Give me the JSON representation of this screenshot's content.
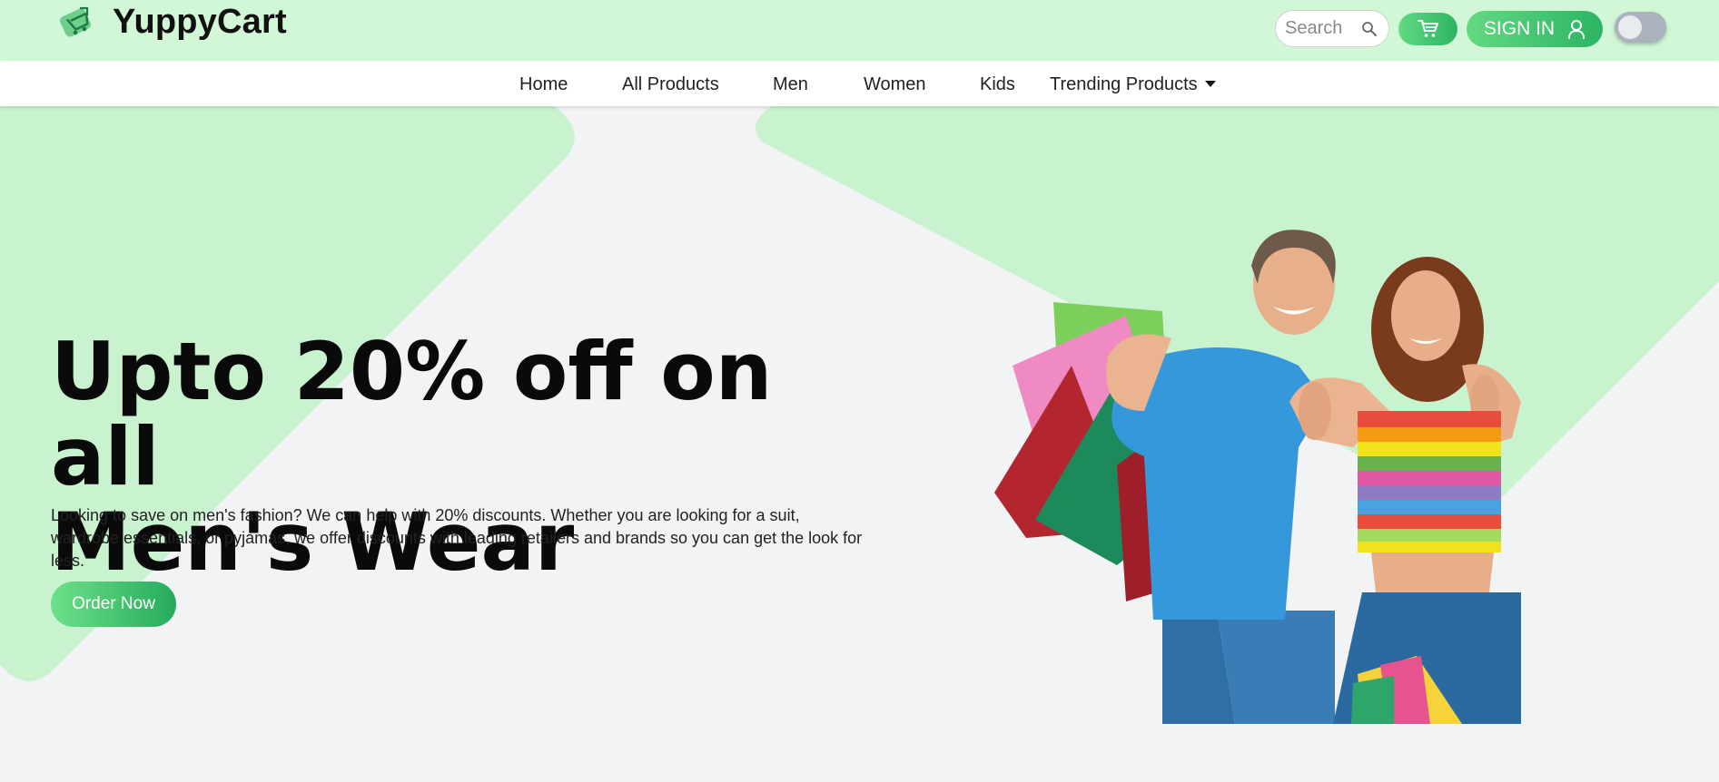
{
  "brand": {
    "name": "YuppyCart",
    "logo_icon": "shopping-cart-logo-icon"
  },
  "header": {
    "search_placeholder": "Search",
    "search_icon": "search-icon",
    "cart_icon": "cart-icon",
    "signin_label": "SIGN IN",
    "user_icon": "user-icon",
    "theme_toggle": "off"
  },
  "nav": {
    "items": [
      {
        "label": "Home"
      },
      {
        "label": "All Products"
      },
      {
        "label": "Men"
      },
      {
        "label": "Women"
      },
      {
        "label": "Kids"
      },
      {
        "label": "Trending Products",
        "has_dropdown": true
      }
    ]
  },
  "hero": {
    "headline_line1": "Upto 20% off on all",
    "headline_line2": "Men's Wear",
    "description": "Looking to save on men's fashion? We can help with 20% discounts. Whether you are looking for a suit, wardrobe essentials, or pyjamas, we offer discounts with leading retailers and brands so you can get the look for less.",
    "cta_label": "Order Now",
    "image_icon": "couple-with-shopping-bags-image"
  },
  "colors": {
    "header_bg": "#d1f7d6",
    "deco_green": "#c9f2cf",
    "accent_start": "#63d982",
    "accent_end": "#2bb463",
    "page_bg": "#f2f3f5"
  }
}
